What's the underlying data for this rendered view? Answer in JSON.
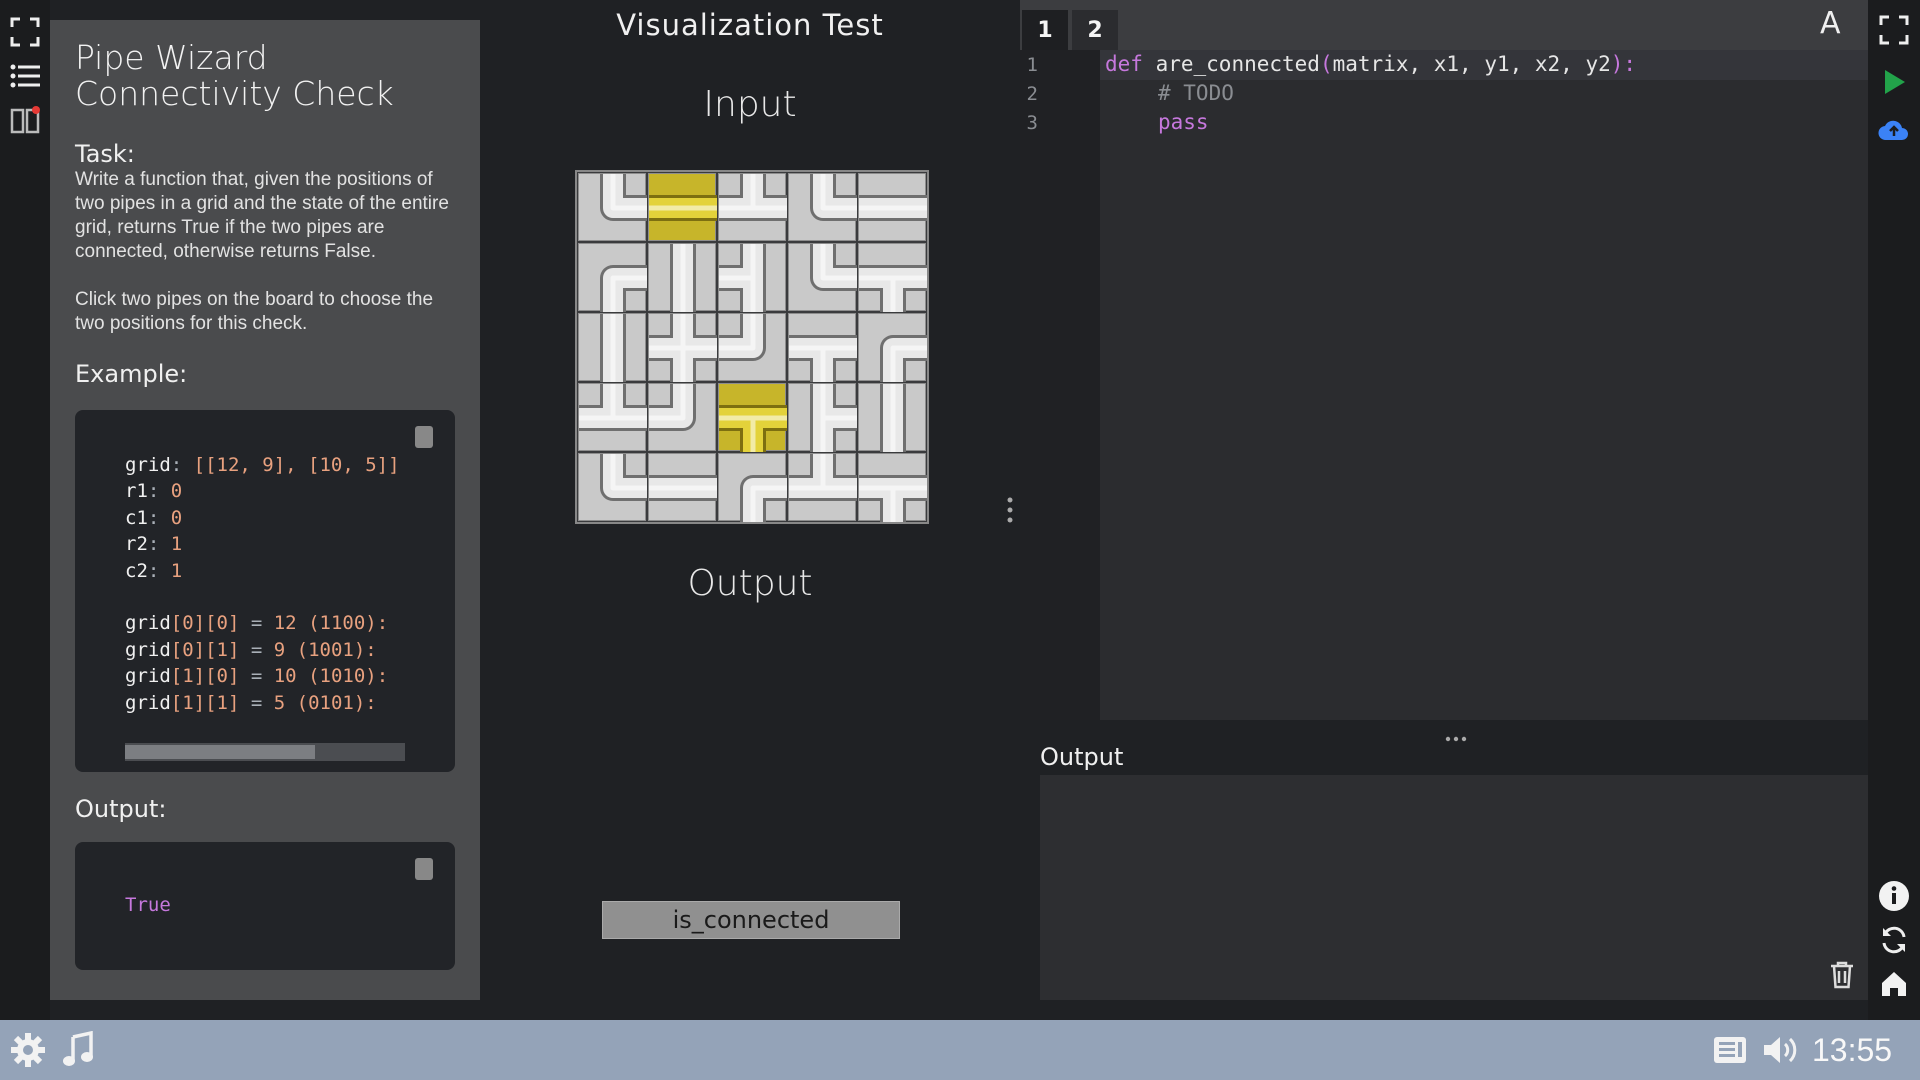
{
  "task": {
    "title": "Pipe Wizard Connectivity Check",
    "task_label": "Task:",
    "description_1": "Write a function that, given the positions of two pipes in a grid and the state of the entire grid, returns True if the two pipes are connected, otherwise returns False.",
    "description_2": "Click two pipes on the board to choose the two positions for this check.",
    "example_label": "Example:",
    "example": {
      "grid_key": "grid",
      "grid_value": "[[12, 9], [10, 5]]",
      "r1_key": "r1",
      "r1_value": "0",
      "c1_key": "c1",
      "c1_value": "0",
      "r2_key": "r2",
      "r2_value": "1",
      "c2_key": "c2",
      "c2_value": "1",
      "lines": [
        {
          "name": "grid",
          "idx": "[0][0]",
          "val": "12",
          "bin": "(1100):"
        },
        {
          "name": "grid",
          "idx": "[0][1]",
          "val": "9",
          "bin": "(1001):"
        },
        {
          "name": "grid",
          "idx": "[1][0]",
          "val": "10",
          "bin": "(1010):"
        },
        {
          "name": "grid",
          "idx": "[1][1]",
          "val": "5",
          "bin": "(0101):"
        }
      ]
    },
    "output_label": "Output:",
    "output_value": "True"
  },
  "visualization": {
    "title": "Visualization Test",
    "input_label": "Input",
    "output_label": "Output",
    "button_label": "is_connected",
    "highlight_color": "#c7b52a",
    "grid": [
      [
        "elbow-up-right",
        "straight-h",
        "tee-up",
        "elbow-up-right",
        "straight-h"
      ],
      [
        "elbow-down-right",
        "straight-v",
        "tee-left-v",
        "elbow-up-right",
        "tee-down"
      ],
      [
        "straight-v",
        "cross",
        "elbow-up-left",
        "tee-down",
        "elbow-down-right"
      ],
      [
        "tee-up",
        "elbow-up-left",
        "tee-down",
        "tee-right-v",
        "straight-v"
      ],
      [
        "elbow-up-right",
        "straight-h",
        "elbow-down-right",
        "tee-up",
        "tee-down"
      ]
    ],
    "highlighted": [
      [
        0,
        1
      ],
      [
        3,
        2
      ]
    ]
  },
  "editor": {
    "tabs": [
      "1",
      "2"
    ],
    "active_tab": "1",
    "font_button": "A",
    "line_numbers": [
      "1",
      "2",
      "3"
    ],
    "code": {
      "kw_def": "def",
      "fn_sig": " are_connected",
      "paren_open": "(",
      "params": "matrix, x1, y1, x2, y2",
      "paren_close": "):",
      "comment": "# TODO",
      "kw_pass": "pass"
    },
    "output_label": "Output",
    "output_text": ""
  },
  "taskbar": {
    "clock": "13:55"
  },
  "colors": {
    "run_green": "#22a34a",
    "cloud_blue": "#3b82f6",
    "taskbar": "#94a3b8"
  }
}
